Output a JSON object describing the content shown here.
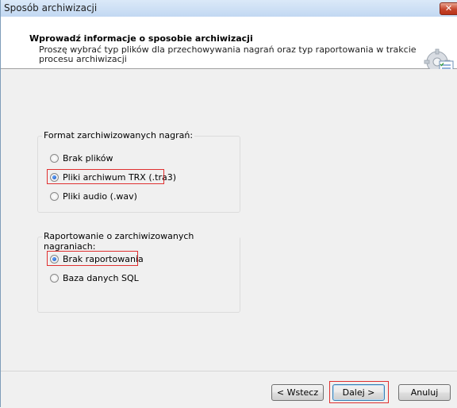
{
  "window": {
    "title": "Sposób archiwizacji",
    "close_symbol": "✕"
  },
  "header": {
    "title": "Wprowadź informacje o sposobie archiwizacji",
    "description": "Proszę wybrać typ plików dla przechowywania nagrań oraz typ raportowania w trakcie procesu archiwizacji",
    "icon": "gear-document-icon"
  },
  "format_group": {
    "title": "Format zarchiwizowanych nagrań:",
    "options": [
      {
        "label": "Brak plików",
        "selected": false
      },
      {
        "label": "Pliki archiwum TRX (.tra3)",
        "selected": true
      },
      {
        "label": "Pliki audio (.wav)",
        "selected": false
      }
    ]
  },
  "report_group": {
    "title": "Raportowanie o zarchiwizowanych nagraniach:",
    "options": [
      {
        "label": "Brak raportowania",
        "selected": true
      },
      {
        "label": "Baza danych SQL",
        "selected": false
      }
    ]
  },
  "buttons": {
    "back": "< Wstecz",
    "next": "Dalej >",
    "cancel": "Anuluj"
  },
  "colors": {
    "highlight": "#e03030",
    "titlebar": "#c2d8f2"
  }
}
